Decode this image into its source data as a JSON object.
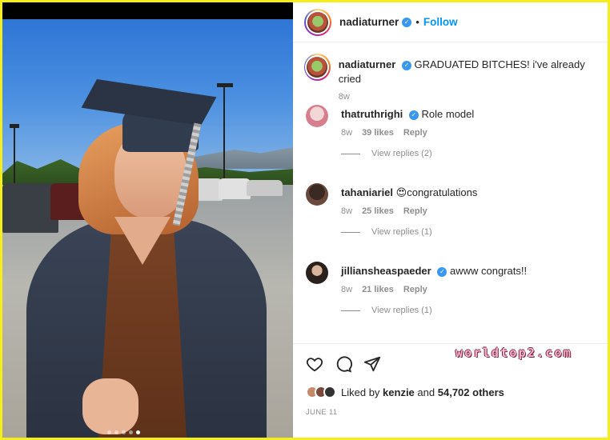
{
  "post": {
    "author": "nadiaturner",
    "follow_label": "Follow",
    "separator": "•",
    "caption": "GRADUATED BITCHES! i've already cried",
    "caption_age": "8w",
    "carousel": {
      "count": 5,
      "active_index": 4
    }
  },
  "comments": [
    {
      "user": "thatruthrighi",
      "text": "Role model",
      "age": "8w",
      "likes": "39 likes",
      "reply_label": "Reply",
      "view_replies": "View replies (2)",
      "verified": true,
      "emoji": ""
    },
    {
      "user": "tahaniariel",
      "text": "congratulations",
      "age": "8w",
      "likes": "25 likes",
      "reply_label": "Reply",
      "view_replies": "View replies (1)",
      "verified": false,
      "emoji": "😍"
    },
    {
      "user": "jilliansheaspaeder",
      "text": "awww congrats!!",
      "age": "8w",
      "likes": "21 likes",
      "reply_label": "Reply",
      "view_replies": "View replies (1)",
      "verified": true,
      "emoji": ""
    }
  ],
  "actions": {
    "icons": [
      "heart-icon",
      "comment-icon",
      "share-icon"
    ]
  },
  "likes": {
    "prefix": "Liked by",
    "user": "kenzie",
    "and": "and",
    "count": "54,702 others"
  },
  "date": "JUNE 11",
  "watermark": "worldtop2.com",
  "colors": {
    "accent": "#0095f6",
    "verified": "#3897f0",
    "frame": "#f5ee1a",
    "muted": "#8e8e8e"
  }
}
